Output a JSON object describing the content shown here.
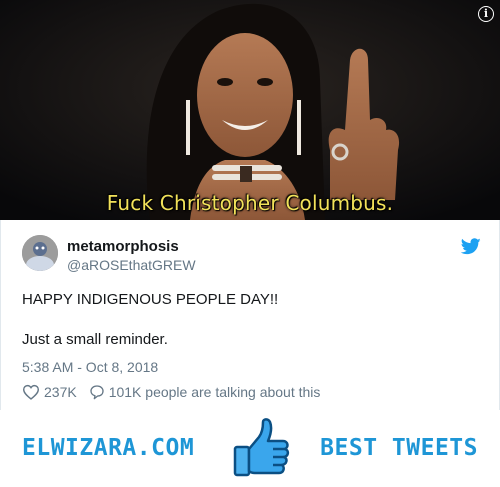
{
  "media": {
    "caption": "Fuck Christopher Columbus.",
    "info_glyph": "i"
  },
  "tweet": {
    "display_name": "metamorphosis",
    "handle": "@aROSEthatGREW",
    "text_lines": [
      "HAPPY INDIGENOUS PEOPLE DAY!!",
      "Just a small reminder."
    ],
    "timestamp": "5:38 AM - Oct 8, 2018",
    "likes": "237K",
    "replies_text": "101K people are talking about this",
    "icons": {
      "brand": "twitter-bird-icon",
      "like": "heart-icon",
      "reply": "speech-bubble-icon"
    }
  },
  "footer": {
    "left_text": "ELWIZARA.COM",
    "right_text": "BEST TWEETS",
    "icon": "thumbs-up-icon"
  },
  "colors": {
    "twitter_blue": "#1da1f2",
    "caption_yellow": "#f2e25a",
    "footer_blue": "#1e96d6",
    "text_primary": "#14171a",
    "text_secondary": "#657786"
  }
}
